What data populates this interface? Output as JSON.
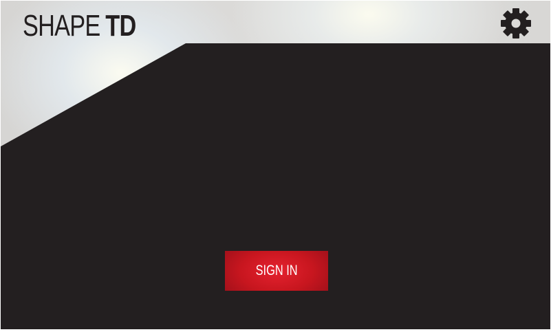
{
  "app": {
    "title_light": "SHAPE",
    "title_bold": "TD"
  },
  "header": {
    "settings_icon": "gear-icon"
  },
  "main": {
    "sign_in_label": "SIGN IN"
  },
  "colors": {
    "background_dark": "#231f20",
    "header_light": "#d6d5d3",
    "button_red": "#d21b26",
    "logo_text": "#231f20"
  }
}
